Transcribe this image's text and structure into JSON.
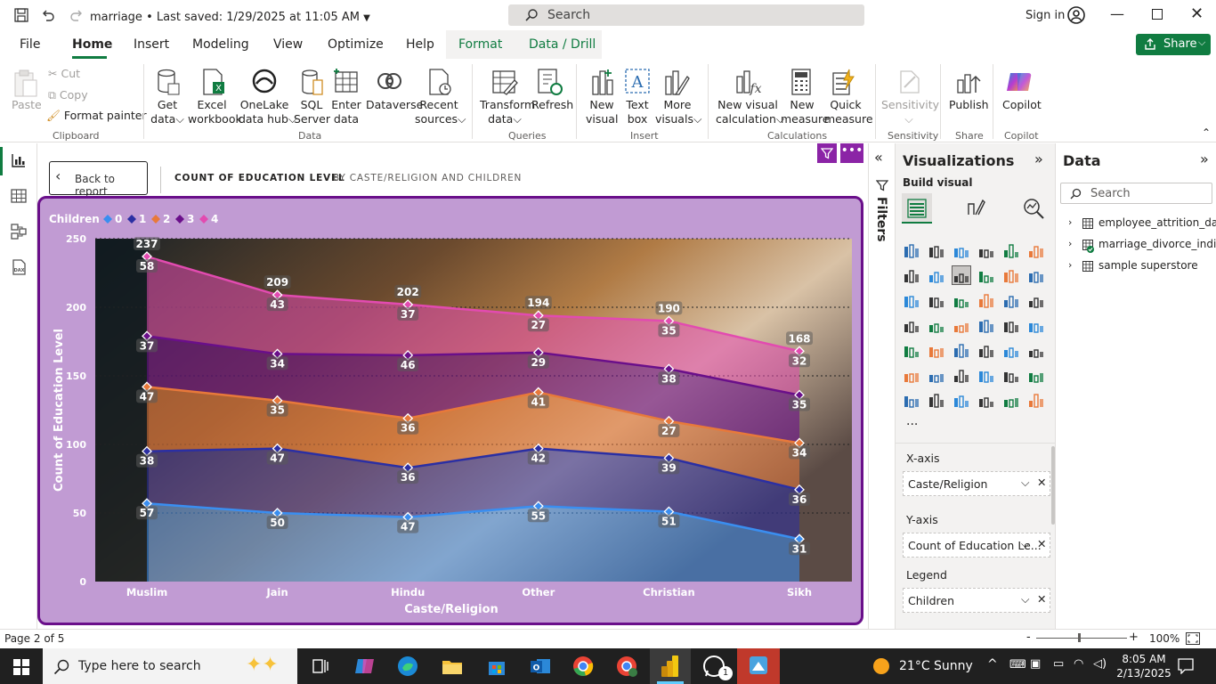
{
  "titlebar": {
    "file_name": "marriage",
    "saved_status": "• Last saved: 1/29/2025 at 11:05 AM",
    "search_label": "Search",
    "sign_in": "Sign in"
  },
  "tabs": [
    {
      "label": "File"
    },
    {
      "label": "Home"
    },
    {
      "label": "Insert"
    },
    {
      "label": "Modeling"
    },
    {
      "label": "View"
    },
    {
      "label": "Optimize"
    },
    {
      "label": "Help"
    },
    {
      "label": "Format"
    },
    {
      "label": "Data / Drill"
    }
  ],
  "share_label": "Share",
  "ribbon": {
    "clipboard": {
      "paste": "Paste",
      "cut": "Cut",
      "copy": "Copy",
      "format_painter": "Format painter",
      "group": "Clipboard"
    },
    "data": {
      "get_data": [
        "Get",
        "data"
      ],
      "excel": [
        "Excel",
        "workbook"
      ],
      "onelake": [
        "OneLake",
        "data hub"
      ],
      "sql": [
        "SQL",
        "Server"
      ],
      "enter": [
        "Enter",
        "data"
      ],
      "dataverse": "Dataverse",
      "recent": [
        "Recent",
        "sources"
      ],
      "group": "Data"
    },
    "queries": {
      "transform": [
        "Transform",
        "data"
      ],
      "refresh": "Refresh",
      "group": "Queries"
    },
    "insert": {
      "new_visual": [
        "New",
        "visual"
      ],
      "text_box": [
        "Text",
        "box"
      ],
      "more_visuals": [
        "More",
        "visuals"
      ],
      "group": "Insert"
    },
    "calculations": {
      "new_visual_calc": [
        "New visual",
        "calculation"
      ],
      "new_measure": [
        "New",
        "measure"
      ],
      "quick_measure": [
        "Quick",
        "measure"
      ],
      "group": "Calculations"
    },
    "sensitivity": {
      "label": "Sensitivity",
      "group": "Sensitivity"
    },
    "share": {
      "publish": "Publish",
      "group": "Share"
    },
    "copilot": {
      "label": "Copilot",
      "group": "Copilot"
    }
  },
  "canvas": {
    "back_label": "Back to report",
    "visual_title": "COUNT OF EDUCATION LEVEL",
    "visual_subtitle": "BY CASTE/RELIGION AND CHILDREN"
  },
  "chart_data": {
    "type": "area",
    "legend_title": "Children",
    "legend_placement": "top-left",
    "xlabel": "Caste/Religion",
    "ylabel": "Count of Education Level",
    "categories": [
      "Muslim",
      "Jain",
      "Hindu",
      "Other",
      "Christian",
      "Sikh"
    ],
    "yticks": [
      "0",
      "50",
      "100",
      "150",
      "200",
      "250"
    ],
    "ylim": [
      0,
      250
    ],
    "stacked": true,
    "series": [
      {
        "name": "0",
        "color": "#3a8ef0",
        "values": [
          57,
          50,
          47,
          55,
          51,
          31
        ]
      },
      {
        "name": "1",
        "color": "#2b2fa3",
        "values": [
          38,
          47,
          36,
          42,
          39,
          36
        ]
      },
      {
        "name": "2",
        "color": "#e8793a",
        "values": [
          47,
          35,
          36,
          41,
          27,
          34
        ]
      },
      {
        "name": "3",
        "color": "#6a0f8a",
        "values": [
          37,
          34,
          46,
          29,
          38,
          35
        ]
      },
      {
        "name": "4",
        "color": "#e24bb0",
        "values": [
          58,
          43,
          37,
          27,
          35,
          32
        ]
      }
    ],
    "totals": [
      237,
      209,
      202,
      194,
      190,
      168
    ]
  },
  "filters_label": "Filters",
  "viz": {
    "title": "Visualizations",
    "build_visual": "Build visual",
    "xaxis_label": "X-axis",
    "xaxis_field": "Caste/Religion",
    "yaxis_label": "Y-axis",
    "yaxis_field": "Count of Education Le...",
    "legend_label": "Legend",
    "legend_field": "Children",
    "more": "..."
  },
  "datapane": {
    "title": "Data",
    "search_placeholder": "Search",
    "tables": [
      {
        "name": "employee_attrition_da..."
      },
      {
        "name": "marriage_divorce_indi..."
      },
      {
        "name": "sample superstore"
      }
    ]
  },
  "status": {
    "page": "Page 2 of 5",
    "zoom": "100%"
  },
  "taskbar": {
    "search_placeholder": "Type here to search",
    "weather": "21°C  Sunny",
    "time": "8:05 AM",
    "date": "2/13/2025",
    "whatsapp_badge": "1"
  }
}
